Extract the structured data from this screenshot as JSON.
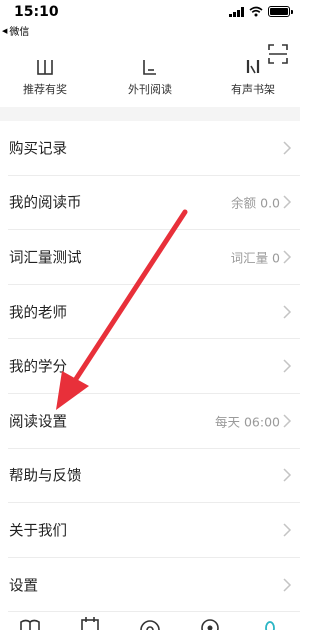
{
  "status_bar": {
    "time": "15:10",
    "back_label": "微信"
  },
  "header": {
    "scan_icon": "scan-icon"
  },
  "shortcuts": [
    {
      "label": "推荐有奖",
      "icon": "gift-icon"
    },
    {
      "label": "外刊阅读",
      "icon": "magazine-icon"
    },
    {
      "label": "有声书架",
      "icon": "headphones-icon"
    }
  ],
  "menu": {
    "items": [
      {
        "title": "购买记录",
        "value": ""
      },
      {
        "title": "我的阅读币",
        "value": "余额 0.0"
      },
      {
        "title": "词汇量测试",
        "value": "词汇量 0"
      },
      {
        "title": "我的老师",
        "value": ""
      },
      {
        "title": "我的学分",
        "value": ""
      },
      {
        "title": "阅读设置",
        "value": "每天 06:00"
      },
      {
        "title": "帮助与反馈",
        "value": ""
      },
      {
        "title": "关于我们",
        "value": ""
      },
      {
        "title": "设置",
        "value": ""
      }
    ]
  },
  "tabbar": {
    "icons": [
      "book-icon",
      "calendar-icon",
      "compass-icon",
      "location-icon",
      "profile-icon"
    ],
    "active_color": "#2bb5c4"
  },
  "colors": {
    "annotation_arrow": "#e8303a",
    "separator": "#f4f4f4",
    "value_text": "#9a9a9a"
  }
}
